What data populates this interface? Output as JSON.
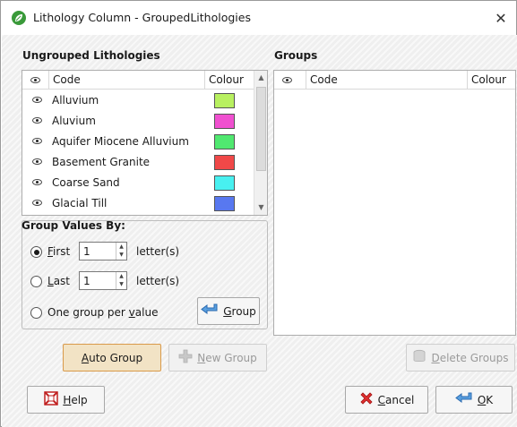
{
  "window": {
    "title": "Lithology Column - GroupedLithologies",
    "close_glyph": "✕"
  },
  "ungrouped": {
    "heading": "Ungrouped Lithologies",
    "columns": {
      "visible": "eye-icon",
      "code": "Code",
      "colour": "Colour"
    },
    "rows": [
      {
        "code": "Alluvium",
        "colour": "#b8f060"
      },
      {
        "code": "Aluvium",
        "colour": "#f050d0"
      },
      {
        "code": "Aquifer Miocene Alluvium",
        "colour": "#50e870"
      },
      {
        "code": "Basement Granite",
        "colour": "#f04848"
      },
      {
        "code": "Coarse Sand",
        "colour": "#48f0f0"
      },
      {
        "code": "Glacial Till",
        "colour": "#5878f0"
      }
    ]
  },
  "groups": {
    "heading": "Groups",
    "columns": {
      "visible": "eye-icon",
      "code": "Code",
      "colour": "Colour"
    }
  },
  "group_values": {
    "heading": "Group Values By:",
    "first": {
      "label_key": "F",
      "label_rest": "irst",
      "value": "1",
      "suffix": "letter(s)",
      "checked": true
    },
    "last": {
      "label_key": "L",
      "label_rest": "ast",
      "value": "1",
      "suffix": "letter(s)",
      "checked": false
    },
    "one_group": {
      "label_pre": "One group per ",
      "label_key": "v",
      "label_rest": "alue",
      "checked": false
    },
    "group_button": {
      "icon": "group-arrow-icon",
      "key": "G",
      "rest": "roup"
    }
  },
  "buttons": {
    "auto_group": {
      "key": "A",
      "rest": "uto Group"
    },
    "new_group": {
      "icon": "plus-icon",
      "key": "N",
      "rest": "ew Group",
      "enabled": false
    },
    "delete_groups": {
      "icon": "database-icon",
      "key": "D",
      "rest": "elete Groups",
      "enabled": false
    },
    "help": {
      "icon": "lifebuoy-icon",
      "key": "H",
      "rest": "elp"
    },
    "cancel": {
      "icon": "red-x-icon",
      "key": "C",
      "rest": "ancel"
    },
    "ok": {
      "icon": "ok-arrow-icon",
      "key": "O",
      "rest": "K"
    }
  },
  "colors": {
    "accent_focus": "#f2e3c5",
    "focus_border": "#d99a4a",
    "app_icon": "#3a9a3a"
  }
}
